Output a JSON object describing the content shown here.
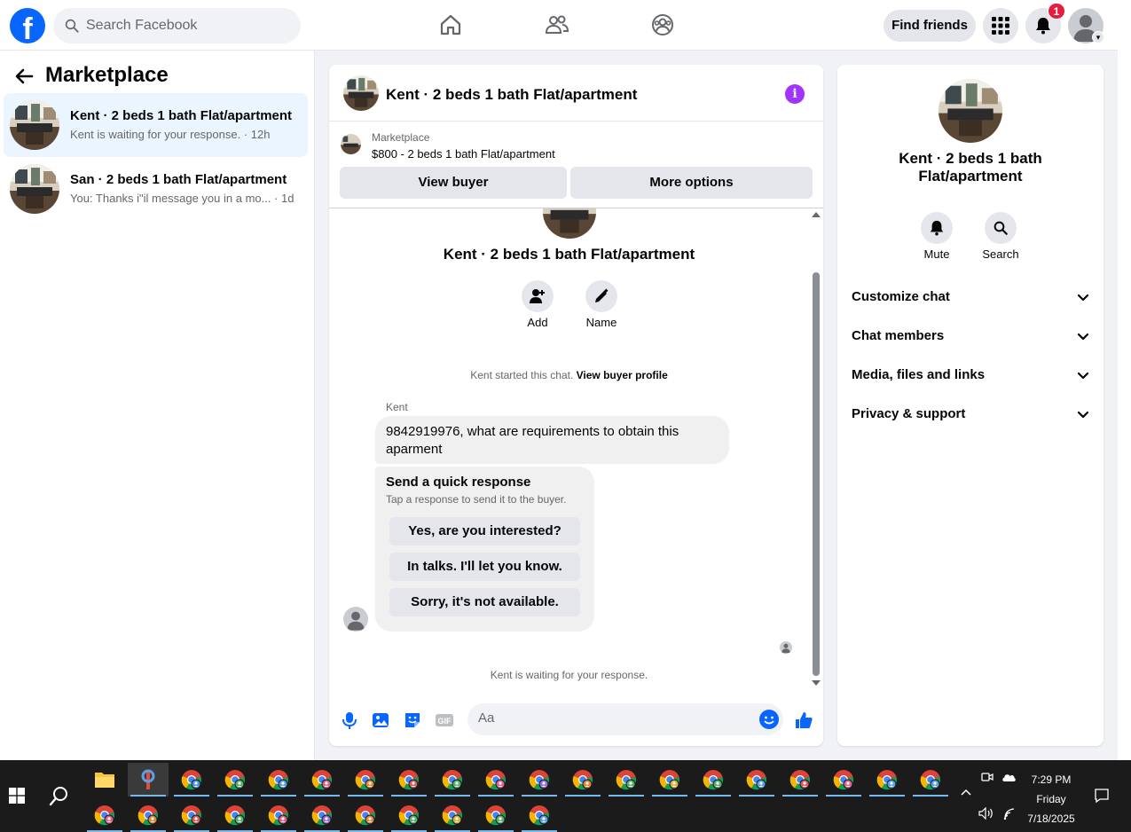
{
  "topbar": {
    "logo_letter": "f",
    "search_placeholder": "Search Facebook",
    "find_friends": "Find friends",
    "notification_count": "1"
  },
  "left": {
    "title": "Marketplace",
    "conversations": [
      {
        "name": "Kent · 2 beds 1 bath Flat/apartment",
        "preview": "Kent is waiting for your response. · 12h"
      },
      {
        "name": "San · 2 beds 1 bath Flat/apartment",
        "preview": "You: Thanks i\"il message you in a mo...  · 1d"
      }
    ]
  },
  "chat": {
    "header_title": "Kent · 2 beds 1 bath Flat/apartment",
    "info_glyph": "i",
    "marketplace_label": "Marketplace",
    "listing": "$800 - 2 beds 1 bath Flat/apartment",
    "view_buyer": "View buyer",
    "more_options": "More options",
    "profile_title": "Kent · 2 beds 1 bath Flat/apartment",
    "add_label": "Add",
    "name_label": "Name",
    "started_text": "Kent started this chat.",
    "started_link": "View buyer profile",
    "sender": "Kent",
    "message": "9842919976, what are requirements to obtain this aparment",
    "quick_title": "Send a quick response",
    "quick_sub": "Tap a response to send it to the buyer.",
    "quick_replies": [
      "Yes, are you interested?",
      "In talks. I'll let you know.",
      "Sorry, it's not available."
    ],
    "waiting": "Kent is waiting for your response.",
    "composer_placeholder": "Aa",
    "gif_label": "GIF"
  },
  "right": {
    "title": "Kent · 2 beds 1 bath Flat/apartment",
    "mute": "Mute",
    "search": "Search",
    "sections": [
      "Customize chat",
      "Chat members",
      "Media, files and links",
      "Privacy & support"
    ]
  },
  "taskbar": {
    "time": "7:29 PM",
    "day": "Friday",
    "date": "7/18/2025"
  },
  "colors": {
    "brand_blue": "#0866ff",
    "active_row": "#ebf5ff",
    "badge_red": "#e41e3f",
    "info_purple": "#a033ff"
  }
}
